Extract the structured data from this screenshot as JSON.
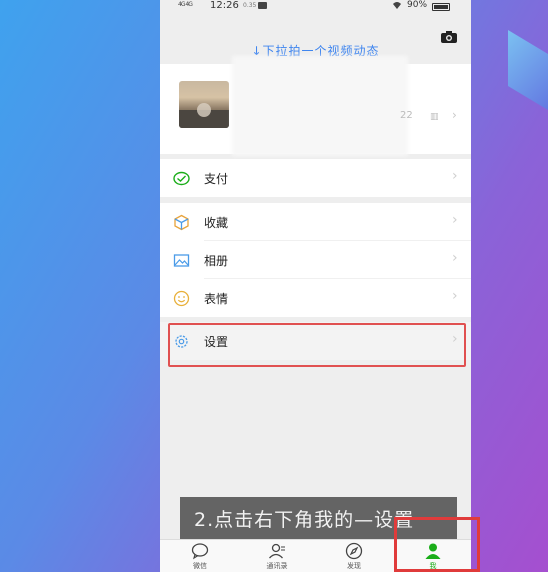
{
  "status_bar": {
    "signal": "4G 4G",
    "time": "12:26",
    "speed": "0.35",
    "battery": "90%"
  },
  "icons": {
    "camera": "camera-icon",
    "pay": "wallet-check-icon",
    "favorites": "cube-icon",
    "album": "image-icon",
    "emoji": "smiley-icon",
    "settings": "gear-icon",
    "chats": "chat-bubble-icon",
    "contacts": "contacts-icon",
    "discover": "compass-icon",
    "me": "person-icon"
  },
  "colors": {
    "wechat_green": "#1aad19",
    "hint_blue": "#3d84ef",
    "highlight_red": "#e05050"
  },
  "header": {
    "pulldown_hint": "↓下拉拍一个视频动态"
  },
  "profile": {
    "meta_text": "22",
    "qr": "▥"
  },
  "menu": {
    "pay": "支付",
    "favorites": "收藏",
    "album": "相册",
    "emoji": "表情",
    "settings": "设置"
  },
  "caption": "2.点击右下角我的—设置",
  "tabs": {
    "chats": "微信",
    "contacts": "通讯录",
    "discover": "发现",
    "me": "我"
  }
}
